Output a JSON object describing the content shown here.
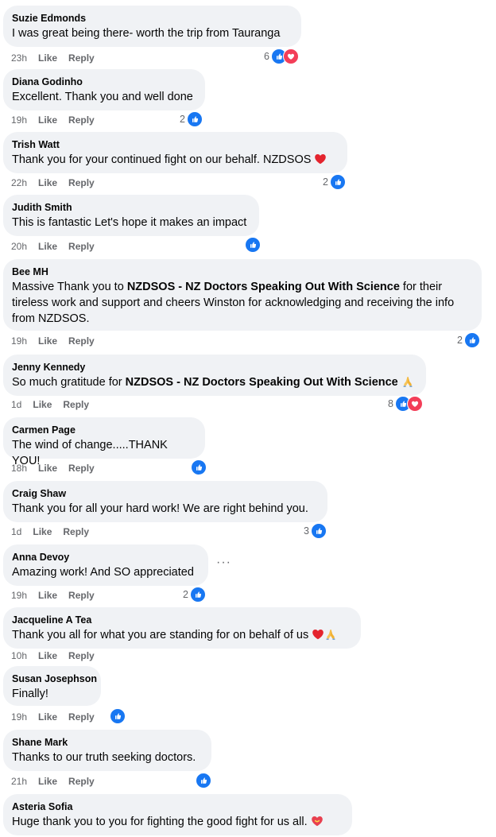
{
  "actions": {
    "like": "Like",
    "reply": "Reply"
  },
  "colors": {
    "like": "#1877f2",
    "love": "#f33e58",
    "bubble": "#f0f2f5",
    "meta": "#65676b"
  },
  "comments": [
    {
      "author": "Suzie Edmonds",
      "text": "I was great being there- worth the trip from Tauranga",
      "time": "23h",
      "reactions": {
        "count": "6",
        "icons": [
          "like",
          "love"
        ]
      }
    },
    {
      "author": "Diana Godinho",
      "text": "Excellent. Thank you and well done",
      "time": "19h",
      "reactions": {
        "count": "2",
        "icons": [
          "like"
        ]
      }
    },
    {
      "author": "Trish Watt",
      "text": "Thank you for your continued fight on our behalf. NZDSOS",
      "emoji": "red-heart",
      "time": "22h",
      "reactions": {
        "count": "2",
        "icons": [
          "like"
        ]
      }
    },
    {
      "author": "Judith Smith",
      "text": "This is fantastic Let's hope it makes an impact",
      "time": "20h",
      "reactions": {
        "count": "",
        "icons": [
          "like"
        ]
      }
    },
    {
      "author": "Bee MH",
      "text_before": "Massive Thank you to ",
      "mention": "NZDSOS - NZ Doctors Speaking Out With Science",
      "text_after": " for their tireless work and support and cheers Winston for acknowledging and receiving the info from NZDSOS.",
      "time": "19h",
      "reactions": {
        "count": "2",
        "icons": [
          "like"
        ]
      }
    },
    {
      "author": "Jenny Kennedy",
      "text_before": "So much gratitude for ",
      "mention": "NZDSOS - NZ Doctors Speaking Out With Science",
      "emoji": "folded-hands",
      "time": "1d",
      "reactions": {
        "count": "8",
        "icons": [
          "like",
          "love"
        ]
      }
    },
    {
      "author": "Carmen Page",
      "text": "The wind of change.....THANK YOU!",
      "time": "18h",
      "reactions": {
        "count": "",
        "icons": [
          "like"
        ]
      }
    },
    {
      "author": "Craig Shaw",
      "text": "Thank you for all your hard work! We are right behind you.",
      "time": "1d",
      "reactions": {
        "count": "3",
        "icons": [
          "like"
        ]
      }
    },
    {
      "author": "Anna Devoy",
      "text": "Amazing work! And SO appreciated",
      "time": "19h",
      "reactions": {
        "count": "2",
        "icons": [
          "like"
        ]
      },
      "more": "···"
    },
    {
      "author": "Jacqueline A Tea",
      "text": "Thank you all for what you are standing for on behalf of us",
      "emoji": "red-heart folded-hands",
      "time": "10h"
    },
    {
      "author": "Susan Josephson",
      "text": "Finally!",
      "time": "19h",
      "reactions": {
        "count": "",
        "icons": [
          "like"
        ]
      }
    },
    {
      "author": "Shane Mark",
      "text": "Thanks to our truth seeking doctors.",
      "time": "21h",
      "reactions": {
        "count": "",
        "icons": [
          "like"
        ]
      }
    },
    {
      "author": "Asteria Sofia",
      "text": "Huge thank you to you for fighting the good fight for us all.",
      "emoji": "heart-with-ribbon"
    }
  ]
}
